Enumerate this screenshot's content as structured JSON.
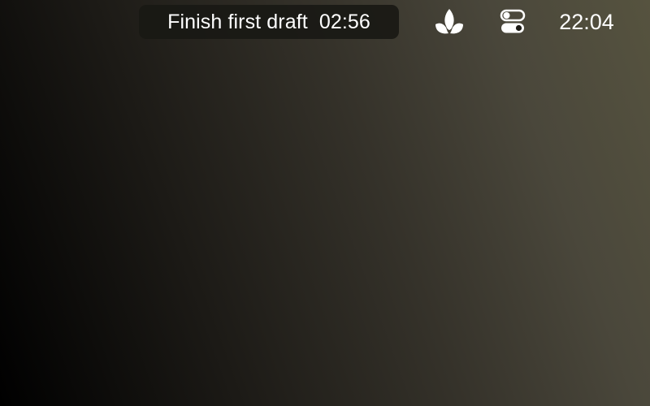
{
  "menubar": {
    "focus_session": {
      "task": "Finish first draft",
      "timer": "02:56",
      "background": "#181814"
    },
    "icons": [
      "lotus-icon",
      "control-center-icon"
    ],
    "clock": "22:04"
  },
  "colors": {
    "text": "#ffffff",
    "wallpaper_dark": "#000000",
    "wallpaper_light": "#56533f"
  }
}
